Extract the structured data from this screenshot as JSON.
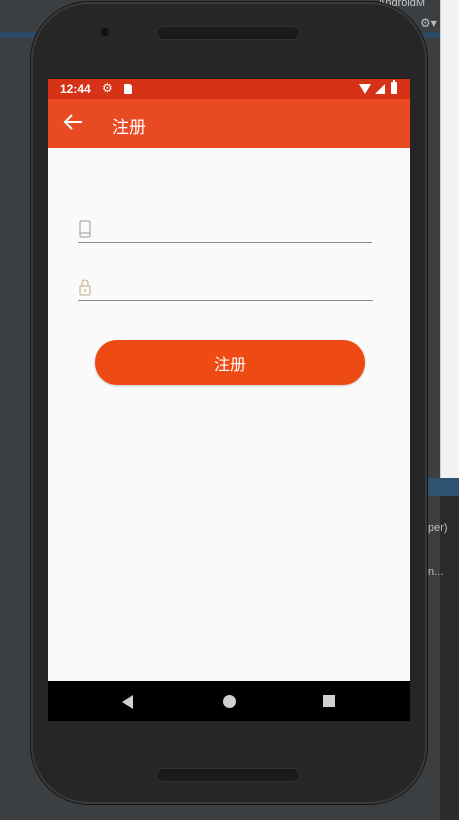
{
  "ide": {
    "title_fragment": "AndroidM",
    "gear_label": "⚙▾",
    "side_texts": [
      "per)",
      "n..."
    ]
  },
  "status_bar": {
    "time": "12:44",
    "color": "#d63217"
  },
  "app_bar": {
    "title": "注册",
    "color": "#e84a24"
  },
  "form": {
    "phone": {
      "value": "",
      "placeholder": ""
    },
    "password": {
      "value": "",
      "placeholder": ""
    },
    "register_label": "注册",
    "button_color": "#ee4a14"
  },
  "icons": {
    "back": "arrow-left-icon",
    "settings": "gear-icon",
    "sd_card": "sd-card-icon",
    "wifi": "wifi-icon",
    "signal": "signal-icon",
    "battery": "battery-icon",
    "phone_field": "phone-icon",
    "password_field": "lock-icon",
    "nav_back": "triangle-back-icon",
    "nav_home": "circle-home-icon",
    "nav_recent": "square-recent-icon"
  }
}
